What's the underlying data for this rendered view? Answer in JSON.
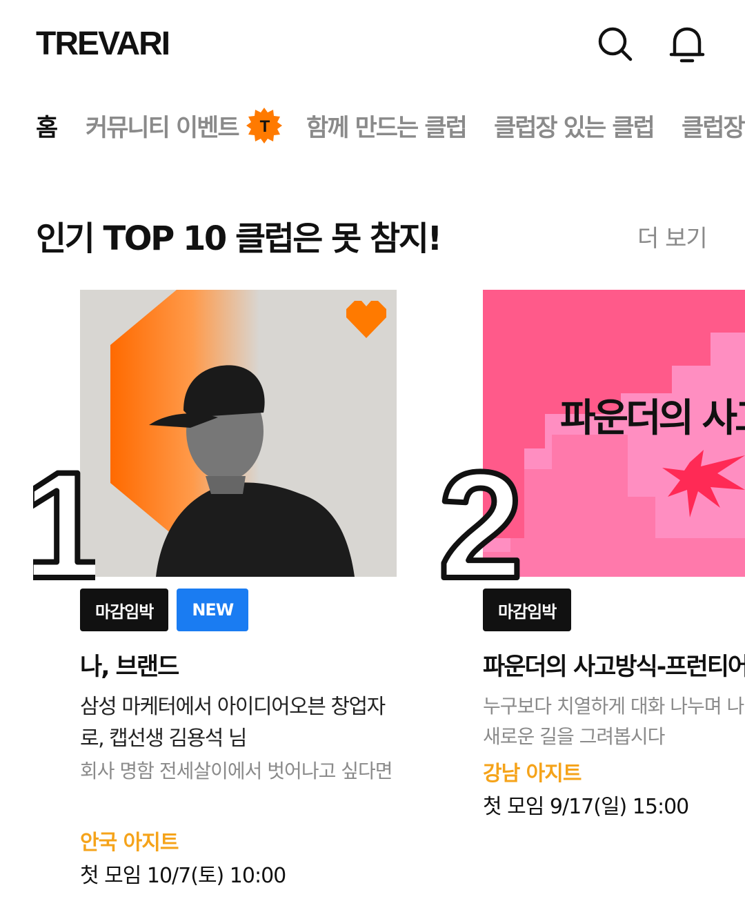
{
  "header": {
    "logo": "TREVARI",
    "icons": [
      "search-icon",
      "bell-icon"
    ]
  },
  "nav": {
    "tabs": [
      {
        "label": "홈",
        "active": true
      },
      {
        "label": "커뮤니티 이벤트",
        "badge": "T"
      },
      {
        "label": "함께 만드는 클럽"
      },
      {
        "label": "클럽장 있는 클럽"
      },
      {
        "label": "클럽장"
      }
    ]
  },
  "section": {
    "title": "인기 TOP 10 클럽은 못 참지!",
    "more": "더 보기"
  },
  "clubs": [
    {
      "rank": "1",
      "tags": [
        "마감임박",
        "NEW"
      ],
      "title": "나, 브랜드",
      "desc": "삼성 마케터에서 아이디어오븐 창업자로, 캡선생 김용석 님",
      "sub": "회사 명함 전세살이에서 벗어나고 싶다면",
      "place": "안국 아지트",
      "time": "첫 모임 10/7(토) 10:00"
    },
    {
      "rank": "2",
      "tags": [
        "마감임박"
      ],
      "title": "파운더의 사고방식-프런티어",
      "image_text": "파운더의 사고방식",
      "desc": "누구보다 치열하게 대화 나누며 나",
      "desc2": "새로운 길을 그려봅시다",
      "place": "강남 아지트",
      "time": "첫 모임 9/17(일) 15:00"
    }
  ],
  "colors": {
    "accent_orange": "#ff7a00",
    "place_yellow": "#f5a31a",
    "new_blue": "#1a7cf2",
    "pink": "#ff5a8a"
  }
}
